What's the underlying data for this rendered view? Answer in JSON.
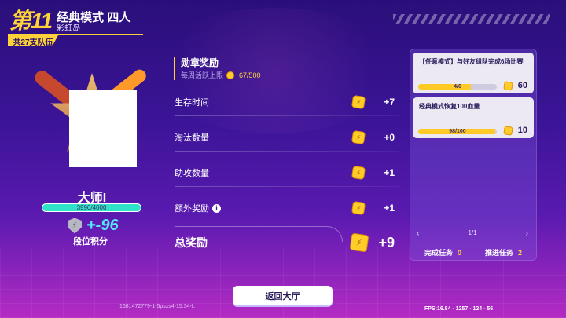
{
  "header": {
    "rank_number": "第11",
    "mode_title": "经典模式 四人",
    "map_name": "彩虹岛",
    "teams_total": "共27支队伍"
  },
  "player": {
    "rank_title": "大师I",
    "progress_text": "3990/4000",
    "progress_fraction": 0.9975,
    "rank_delta": "+-96",
    "rank_score_label": "段位积分"
  },
  "medal": {
    "title": "勋章奖励",
    "daily_cap_label": "每周活跃上限",
    "daily_cap_progress": "67/500"
  },
  "rewards": [
    {
      "label": "生存时间",
      "value": "+7"
    },
    {
      "label": "淘汰数量",
      "value": "+0"
    },
    {
      "label": "助攻数量",
      "value": "+1"
    },
    {
      "label": "额外奖励",
      "value": "+1"
    }
  ],
  "total": {
    "label": "总奖励",
    "value": "+9"
  },
  "tasks": [
    {
      "text": "【任意模式】与好友组队完成6场比赛",
      "progress": "4/6",
      "fraction": 0.667,
      "reward": "60"
    },
    {
      "text": "经典模式恢复100血量",
      "progress": "98/100",
      "fraction": 0.98,
      "reward": "10"
    }
  ],
  "pager": {
    "prev": "‹",
    "page": "1/1",
    "next": "›"
  },
  "task_summary": {
    "completed_label": "完成任务",
    "completed_value": "0",
    "advanced_label": "推进任务",
    "advanced_value": "2"
  },
  "footer": {
    "return_button": "返回大厅",
    "build_id": "1681472779-1-5psxs4-15.34-L",
    "fps_text": "FPS:16.84 - 1257 - 124 - 56"
  },
  "colors": {
    "accent": "#ffd23a",
    "progress": "#2fe3c9",
    "delta": "#55eaff"
  },
  "icons": [
    "shield-icon",
    "coin-icon",
    "info-icon",
    "chevron-left-icon",
    "chevron-right-icon"
  ]
}
